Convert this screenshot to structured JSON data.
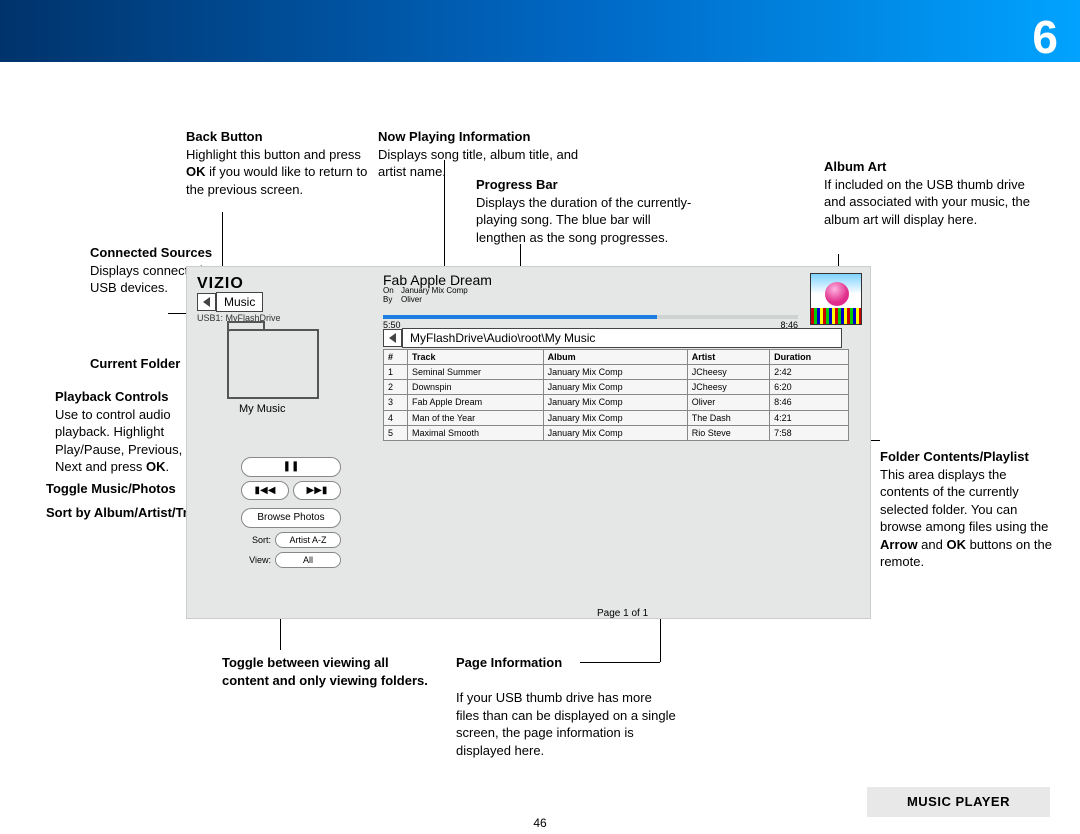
{
  "header": {
    "chapter": "6",
    "page_number": "46",
    "footer_label": "MUSIC PLAYER"
  },
  "callouts": {
    "back_button": {
      "title": "Back Button",
      "body_1": "Highlight this button and press ",
      "bold_1": "OK",
      "body_2": " if you would like to return to the previous screen."
    },
    "connected_sources": {
      "title": "Connected Sources",
      "body": "Displays connected USB devices."
    },
    "current_folder": {
      "title": "Current Folder"
    },
    "playback_controls": {
      "title": "Playback Controls",
      "body_1": "Use to control audio playback. Highlight Play/Pause, Previous, or Next and press ",
      "bold_1": "OK",
      "body_2": "."
    },
    "toggle_music_photos": {
      "title": "Toggle Music/Photos"
    },
    "sort": {
      "title": "Sort by Album/Artist/Track"
    },
    "toggle_view": {
      "title": "Toggle between viewing all content and only viewing folders."
    },
    "now_playing": {
      "title": "Now Playing Information",
      "body": "Displays song title, album title, and artist name."
    },
    "progress_bar": {
      "title": "Progress Bar",
      "body": "Displays the duration of the currently-playing song. The blue bar will lengthen as the song progresses."
    },
    "page_info": {
      "title": "Page Information",
      "body": "If your USB thumb drive has more files than can be displayed on a single screen, the page information is displayed here."
    },
    "album_art": {
      "title": "Album Art",
      "body": "If included on the USB thumb drive and associated with your music, the album art will display here."
    },
    "folder_contents": {
      "title": "Folder Contents/Playlist",
      "body_1": "This area displays the contents of the currently selected folder. You can browse among files using the ",
      "bold_1": "Arrow",
      "body_2": " and ",
      "bold_2": "OK",
      "body_3": " buttons on the remote."
    }
  },
  "player": {
    "brand": "VIZIO",
    "nav_label": "Music",
    "usb_source": "USB1: MyFlashDrive",
    "folder_name": "My Music",
    "controls": {
      "pause": "❚❚",
      "prev": "▮◀◀",
      "next": "▶▶▮",
      "browse_photos": "Browse Photos",
      "sort_label": "Sort:",
      "sort_value": "Artist A-Z",
      "view_label": "View:",
      "view_value": "All"
    },
    "now_playing": {
      "title": "Fab Apple Dream",
      "on_label": "On",
      "on_value": "January Mix Comp",
      "by_label": "By",
      "by_value": "Oliver",
      "elapsed": "5:50",
      "total": "8:46"
    },
    "breadcrumb": "MyFlashDrive\\Audio\\root\\My Music",
    "columns": {
      "num": "#",
      "track": "Track",
      "album": "Album",
      "artist": "Artist",
      "duration": "Duration"
    },
    "tracks": [
      {
        "n": "1",
        "track": "Seminal Summer",
        "album": "January Mix Comp",
        "artist": "JCheesy",
        "duration": "2:42"
      },
      {
        "n": "2",
        "track": "Downspin",
        "album": "January Mix Comp",
        "artist": "JCheesy",
        "duration": "6:20"
      },
      {
        "n": "3",
        "track": "Fab Apple Dream",
        "album": "January Mix Comp",
        "artist": "Oliver",
        "duration": "8:46"
      },
      {
        "n": "4",
        "track": "Man of the Year",
        "album": "January Mix Comp",
        "artist": "The Dash",
        "duration": "4:21"
      },
      {
        "n": "5",
        "track": "Maximal Smooth",
        "album": "January Mix Comp",
        "artist": "Rio Steve",
        "duration": "7:58"
      }
    ],
    "page_info": "Page 1 of 1"
  }
}
